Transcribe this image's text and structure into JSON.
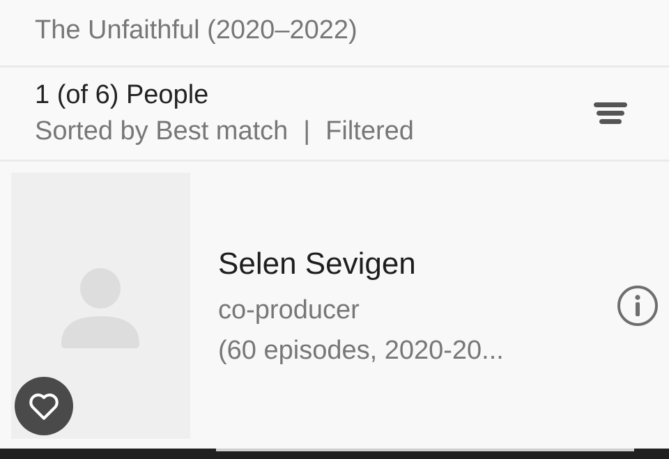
{
  "header": {
    "show_title": "The Unfaithful (2020–2022)"
  },
  "results": {
    "count_label": "1 (of 6) People",
    "sorted_label": "Sorted by Best match",
    "separator": "|",
    "filter_label": "Filtered",
    "sort_icon": "sort-lines-icon"
  },
  "person": {
    "name": "Selen Sevigen",
    "role": "co-producer",
    "episodes": "(60 episodes, 2020-20...",
    "photo_icon": "person-placeholder-icon",
    "favorite_icon": "heart-outline-icon",
    "info_icon": "info-icon"
  },
  "colors": {
    "primary_text": "#222222",
    "secondary_text": "#777777",
    "divider": "#eaeaea",
    "fav_button_bg": "#4a4a4a"
  }
}
